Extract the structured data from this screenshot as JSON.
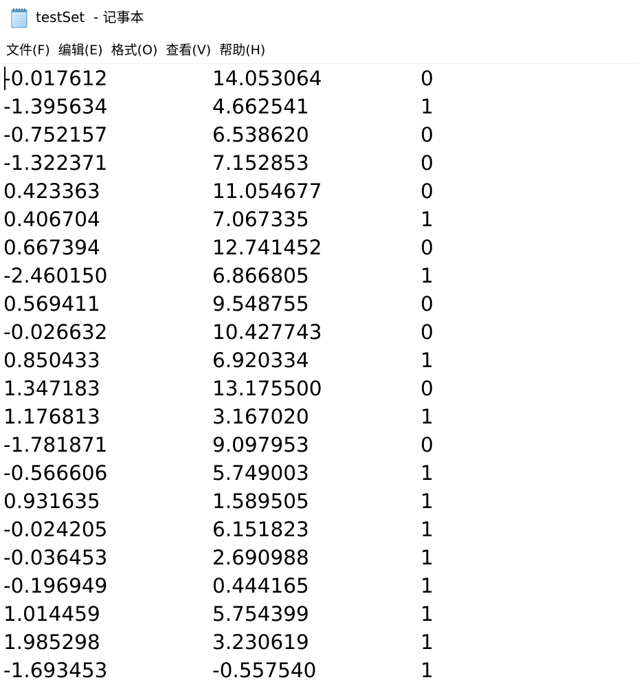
{
  "window": {
    "title": "testSet  - 记事本",
    "icon": "notepad-icon"
  },
  "menu": {
    "items": [
      "文件(F)",
      "编辑(E)",
      "格式(O)",
      "查看(V)",
      "帮助(H)"
    ]
  },
  "document": {
    "rows": [
      [
        "-0.017612",
        "14.053064",
        "0"
      ],
      [
        "-1.395634",
        "4.662541",
        "1"
      ],
      [
        "-0.752157",
        "6.538620",
        "0"
      ],
      [
        "-1.322371",
        "7.152853",
        "0"
      ],
      [
        "0.423363",
        "11.054677",
        "0"
      ],
      [
        "0.406704",
        "7.067335",
        "1"
      ],
      [
        "0.667394",
        "12.741452",
        "0"
      ],
      [
        "-2.460150",
        "6.866805",
        "1"
      ],
      [
        "0.569411",
        "9.548755",
        "0"
      ],
      [
        "-0.026632",
        "10.427743",
        "0"
      ],
      [
        "0.850433",
        "6.920334",
        "1"
      ],
      [
        "1.347183",
        "13.175500",
        "0"
      ],
      [
        "1.176813",
        "3.167020",
        "1"
      ],
      [
        "-1.781871",
        "9.097953",
        "0"
      ],
      [
        "-0.566606",
        "5.749003",
        "1"
      ],
      [
        "0.931635",
        "1.589505",
        "1"
      ],
      [
        "-0.024205",
        "6.151823",
        "1"
      ],
      [
        "-0.036453",
        "2.690988",
        "1"
      ],
      [
        "-0.196949",
        "0.444165",
        "1"
      ],
      [
        "1.014459",
        "5.754399",
        "1"
      ],
      [
        "1.985298",
        "3.230619",
        "1"
      ],
      [
        "-1.693453",
        "-0.557540",
        "1"
      ]
    ]
  }
}
